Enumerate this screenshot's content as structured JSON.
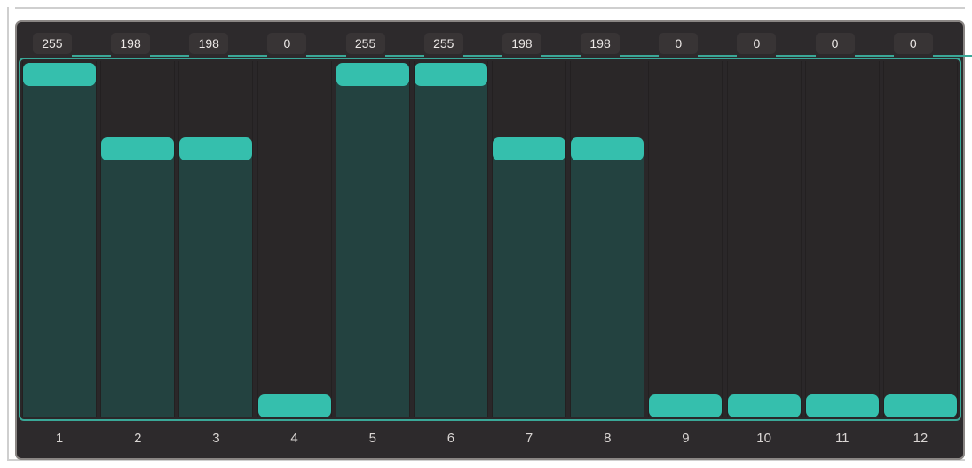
{
  "colors": {
    "background": "#2d2a2c",
    "accent": "#35bfad",
    "fill": "#234240",
    "border": "#8a8684"
  },
  "channels": [
    {
      "label": "1",
      "value": "255",
      "level": 1.0
    },
    {
      "label": "2",
      "value": "198",
      "level": 0.7765
    },
    {
      "label": "3",
      "value": "198",
      "level": 0.7765
    },
    {
      "label": "4",
      "value": "0",
      "level": 0.0
    },
    {
      "label": "5",
      "value": "255",
      "level": 1.0
    },
    {
      "label": "6",
      "value": "255",
      "level": 1.0
    },
    {
      "label": "7",
      "value": "198",
      "level": 0.7765
    },
    {
      "label": "8",
      "value": "198",
      "level": 0.7765
    },
    {
      "label": "9",
      "value": "0",
      "level": 0.0
    },
    {
      "label": "10",
      "value": "0",
      "level": 0.0
    },
    {
      "label": "11",
      "value": "0",
      "level": 0.0
    },
    {
      "label": "12",
      "value": "0",
      "level": 0.0
    }
  ]
}
